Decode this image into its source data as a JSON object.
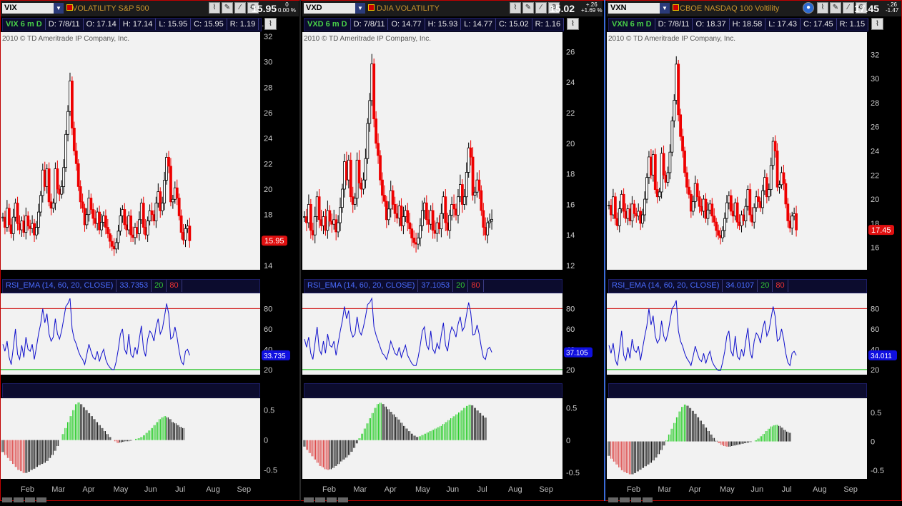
{
  "copyright": "2010 © TD Ameritrade IP Company, Inc.",
  "colors": {
    "up": "#000000",
    "down": "#ee0000",
    "rsi_line": "#1010cc",
    "overbought": "#cc0000",
    "oversold": "#00bb00",
    "macd_up": "#22cc22",
    "macd_down": "#dd4444",
    "bg": "#f2f2f2"
  },
  "icons": [
    "chart-style-icon",
    "drawing-icon",
    "studies-icon",
    "settings-icon"
  ],
  "panels": [
    {
      "symbol": "VIX",
      "description": "VOLATILITY S&P 500",
      "price": "15.95",
      "change": "0",
      "change_pct": "0.00 %",
      "info": {
        "name": "VIX 6 m D",
        "date": "D: 7/8/11",
        "open": "O: 17.14",
        "high": "H: 17.14",
        "low": "L: 15.95",
        "close": "C: 15.95",
        "range": "R: 1.19",
        "more": "..."
      },
      "price_tag": "15.95",
      "rsi": {
        "label": "RSI_EMA (14, 60, 20, CLOSE)",
        "value": "33.7353",
        "ob": "20",
        "os": "80",
        "tag": "33.735"
      }
    },
    {
      "symbol": "VXD",
      "description": "DJIA VOLATILITY",
      "price": "15.02",
      "change": "+.26",
      "change_pct": "+1.69 %",
      "info": {
        "name": "VXD 6 m D",
        "date": "D: 7/8/11",
        "open": "O: 14.77",
        "high": "H: 15.93",
        "low": "L: 14.77",
        "close": "C: 15.02",
        "range": "R: 1.16",
        "more": "..."
      },
      "price_tag": "",
      "rsi": {
        "label": "RSI_EMA (14, 60, 20, CLOSE)",
        "value": "37.1053",
        "ob": "20",
        "os": "80",
        "tag": "37.105"
      }
    },
    {
      "symbol": "VXN",
      "description": "CBOE NASDAQ 100 Voltility",
      "price": "17.45",
      "change": "-.26",
      "change_pct": "-1.47",
      "info": {
        "name": "VXN 6 m D",
        "date": "D: 7/8/11",
        "open": "O: 18.37",
        "high": "H: 18.58",
        "low": "L: 17.43",
        "close": "C: 17.45",
        "range": "R: 1.15",
        "more": "..."
      },
      "price_tag": "17.45",
      "rsi": {
        "label": "RSI_EMA (14, 60, 20, CLOSE)",
        "value": "34.0107",
        "ob": "20",
        "os": "80",
        "tag": "34.011"
      }
    }
  ],
  "chart_data": [
    {
      "type": "line",
      "title": "VIX 6 m D",
      "x_ticks": [
        "Feb",
        "Mar",
        "Apr",
        "May",
        "Jun",
        "Jul",
        "Aug",
        "Sep"
      ],
      "price_axis": {
        "ticks": [
          14,
          16,
          18,
          20,
          22,
          24,
          26,
          28,
          30,
          32
        ],
        "ylim": [
          14,
          32
        ]
      },
      "close": [
        17.8,
        17.0,
        18.5,
        17.2,
        16.5,
        17.8,
        18.9,
        17.3,
        16.8,
        17.5,
        16.6,
        17.9,
        17.1,
        16.9,
        17.3,
        16.4,
        17.0,
        18.2,
        19.5,
        21.5,
        20.2,
        21.6,
        19.0,
        18.5,
        18.9,
        21.6,
        20.0,
        19.6,
        20.2,
        21.7,
        24.3,
        26.1,
        28.5,
        24.8,
        23.0,
        22.0,
        20.2,
        19.0,
        18.5,
        17.2,
        18.0,
        19.3,
        18.4,
        17.7,
        17.3,
        18.2,
        16.8,
        17.4,
        17.9,
        17.0,
        16.5,
        15.9,
        15.5,
        15.3,
        15.8,
        16.7,
        17.9,
        18.4,
        17.2,
        16.8,
        17.9,
        16.4,
        16.2,
        17.0,
        16.5,
        17.6,
        18.9,
        17.0,
        16.4,
        17.5,
        18.3,
        18.0,
        17.5,
        18.9,
        19.8,
        18.3,
        18.9,
        20.7,
        22.5,
        21.8,
        19.0,
        19.2,
        20.1,
        19.3,
        17.9,
        16.6,
        16.0,
        16.9,
        17.1,
        15.95
      ],
      "rsi_axis": {
        "ticks": [
          20,
          40,
          60,
          80
        ],
        "ylim": [
          15,
          95
        ]
      },
      "rsi": [
        45,
        38,
        48,
        32,
        25,
        42,
        60,
        35,
        30,
        44,
        32,
        52,
        40,
        38,
        45,
        30,
        42,
        55,
        65,
        80,
        66,
        75,
        55,
        48,
        52,
        70,
        55,
        50,
        58,
        70,
        82,
        85,
        90,
        60,
        50,
        45,
        38,
        33,
        30,
        25,
        35,
        45,
        38,
        32,
        30,
        38,
        28,
        35,
        40,
        30,
        25,
        22,
        20,
        20,
        28,
        40,
        55,
        60,
        40,
        35,
        55,
        35,
        32,
        42,
        35,
        50,
        63,
        40,
        33,
        50,
        58,
        55,
        48,
        62,
        70,
        55,
        60,
        72,
        85,
        75,
        50,
        52,
        62,
        52,
        38,
        28,
        25,
        38,
        40,
        34
      ],
      "macd_axis": {
        "ticks": [
          -0.5,
          0,
          0.5
        ],
        "ylim": [
          -0.65,
          0.7
        ]
      },
      "macd": [
        -0.2,
        -0.25,
        -0.3,
        -0.35,
        -0.4,
        -0.45,
        -0.5,
        -0.52,
        -0.55,
        -0.55,
        -0.53,
        -0.5,
        -0.48,
        -0.45,
        -0.42,
        -0.4,
        -0.38,
        -0.35,
        -0.3,
        -0.25,
        -0.18,
        -0.1,
        0.0,
        0.1,
        0.2,
        0.3,
        0.4,
        0.5,
        0.6,
        0.63,
        0.6,
        0.55,
        0.5,
        0.45,
        0.4,
        0.35,
        0.3,
        0.25,
        0.2,
        0.15,
        0.1,
        0.05,
        0.0,
        -0.02,
        -0.05,
        -0.04,
        -0.03,
        -0.02,
        -0.02,
        -0.01,
        0.0,
        0.02,
        0.03,
        0.05,
        0.08,
        0.12,
        0.16,
        0.2,
        0.25,
        0.3,
        0.35,
        0.38,
        0.4,
        0.38,
        0.35,
        0.3,
        0.28,
        0.25,
        0.22,
        0.2
      ]
    },
    {
      "type": "line",
      "title": "VXD 6 m D",
      "x_ticks": [
        "Feb",
        "Mar",
        "Apr",
        "May",
        "Jun",
        "Jul",
        "Aug",
        "Sep"
      ],
      "price_axis": {
        "ticks": [
          12,
          14,
          16,
          18,
          20,
          22,
          24,
          26
        ],
        "ylim": [
          12,
          27
        ]
      },
      "close": [
        15.2,
        14.8,
        16.0,
        14.3,
        14.0,
        15.2,
        16.5,
        15.0,
        14.6,
        15.2,
        14.3,
        15.6,
        14.9,
        14.7,
        15.0,
        14.2,
        14.8,
        15.8,
        17.0,
        18.8,
        17.6,
        18.9,
        16.5,
        16.0,
        16.4,
        18.9,
        17.4,
        17.0,
        17.6,
        19.0,
        21.3,
        22.8,
        25.2,
        21.6,
        20.0,
        19.2,
        17.6,
        16.6,
        16.2,
        15.0,
        15.7,
        16.9,
        16.0,
        15.4,
        15.1,
        15.9,
        14.6,
        15.2,
        15.6,
        14.8,
        14.4,
        13.8,
        13.5,
        13.4,
        13.8,
        14.6,
        15.6,
        16.1,
        15.0,
        14.7,
        15.6,
        14.3,
        14.1,
        14.8,
        14.4,
        15.4,
        16.5,
        14.8,
        14.3,
        15.3,
        16.0,
        15.7,
        15.3,
        16.5,
        17.3,
        16.0,
        16.5,
        18.1,
        19.7,
        19.1,
        16.6,
        16.8,
        17.6,
        16.9,
        15.6,
        14.5,
        14.0,
        14.8,
        14.9,
        15.02
      ],
      "rsi_axis": {
        "ticks": [
          20,
          40,
          60,
          80
        ],
        "ylim": [
          15,
          95
        ]
      },
      "rsi": [
        50,
        42,
        52,
        36,
        30,
        46,
        62,
        40,
        35,
        48,
        36,
        55,
        44,
        42,
        48,
        34,
        46,
        58,
        68,
        82,
        70,
        78,
        58,
        52,
        55,
        72,
        58,
        54,
        62,
        72,
        84,
        86,
        90,
        62,
        54,
        48,
        42,
        36,
        34,
        30,
        38,
        48,
        42,
        36,
        34,
        42,
        32,
        38,
        44,
        34,
        30,
        26,
        24,
        24,
        32,
        44,
        58,
        62,
        44,
        40,
        58,
        40,
        36,
        46,
        40,
        54,
        66,
        44,
        38,
        54,
        62,
        58,
        52,
        65,
        72,
        58,
        62,
        74,
        86,
        76,
        54,
        55,
        64,
        55,
        42,
        32,
        30,
        40,
        42,
        37
      ],
      "macd_axis": {
        "ticks": [
          -0.5,
          0,
          0.5
        ],
        "ylim": [
          -0.6,
          0.65
        ]
      },
      "macd": [
        -0.1,
        -0.15,
        -0.2,
        -0.25,
        -0.3,
        -0.35,
        -0.4,
        -0.42,
        -0.45,
        -0.46,
        -0.45,
        -0.43,
        -0.4,
        -0.37,
        -0.33,
        -0.3,
        -0.27,
        -0.23,
        -0.18,
        -0.12,
        -0.05,
        0.03,
        0.1,
        0.18,
        0.26,
        0.34,
        0.42,
        0.5,
        0.56,
        0.58,
        0.56,
        0.52,
        0.48,
        0.44,
        0.4,
        0.36,
        0.32,
        0.27,
        0.22,
        0.18,
        0.14,
        0.1,
        0.07,
        0.05,
        0.06,
        0.08,
        0.1,
        0.12,
        0.14,
        0.16,
        0.18,
        0.2,
        0.22,
        0.25,
        0.28,
        0.31,
        0.34,
        0.37,
        0.4,
        0.43,
        0.46,
        0.5,
        0.53,
        0.55,
        0.54,
        0.5,
        0.46,
        0.42,
        0.38,
        0.35
      ]
    },
    {
      "type": "line",
      "title": "VXN 6 m D",
      "x_ticks": [
        "Feb",
        "Mar",
        "Apr",
        "May",
        "Jun",
        "Jul",
        "Aug",
        "Sep"
      ],
      "price_axis": {
        "ticks": [
          16,
          18,
          20,
          22,
          24,
          26,
          28,
          30,
          32
        ],
        "ylim": [
          14.5,
          33.5
        ]
      },
      "close": [
        19.5,
        18.7,
        20.2,
        18.4,
        17.8,
        19.2,
        20.4,
        19.0,
        18.4,
        19.2,
        18.2,
        19.6,
        18.8,
        18.6,
        19.0,
        18.0,
        18.7,
        20.0,
        21.8,
        23.5,
        22.0,
        23.7,
        20.8,
        20.2,
        20.6,
        23.8,
        22.0,
        21.4,
        22.2,
        23.9,
        26.5,
        28.2,
        31.2,
        27.0,
        25.2,
        24.0,
        22.2,
        21.0,
        20.4,
        19.0,
        19.8,
        21.3,
        20.2,
        19.4,
        19.0,
        20.0,
        18.4,
        19.1,
        19.6,
        18.6,
        18.1,
        17.4,
        17.0,
        16.8,
        17.4,
        18.4,
        19.7,
        20.3,
        19.0,
        18.6,
        19.7,
        18.1,
        17.8,
        18.7,
        18.2,
        19.4,
        20.8,
        18.7,
        18.1,
        19.3,
        20.2,
        19.8,
        19.3,
        20.7,
        21.8,
        20.2,
        20.8,
        22.8,
        24.8,
        24.0,
        21.0,
        21.2,
        22.2,
        21.3,
        19.6,
        18.2,
        17.6,
        18.6,
        18.8,
        17.45
      ],
      "rsi_axis": {
        "ticks": [
          20,
          40,
          60,
          80
        ],
        "ylim": [
          15,
          95
        ]
      },
      "rsi": [
        44,
        36,
        46,
        30,
        24,
        40,
        58,
        34,
        29,
        42,
        31,
        50,
        39,
        37,
        43,
        29,
        41,
        53,
        63,
        80,
        64,
        73,
        53,
        46,
        50,
        68,
        53,
        48,
        56,
        68,
        80,
        83,
        88,
        58,
        48,
        43,
        36,
        31,
        28,
        24,
        33,
        43,
        36,
        30,
        28,
        36,
        26,
        33,
        38,
        28,
        24,
        21,
        19,
        19,
        27,
        38,
        53,
        58,
        38,
        33,
        53,
        33,
        30,
        40,
        33,
        48,
        61,
        38,
        31,
        48,
        56,
        53,
        46,
        60,
        68,
        53,
        58,
        70,
        82,
        72,
        48,
        50,
        60,
        50,
        36,
        27,
        24,
        36,
        38,
        34
      ],
      "macd_axis": {
        "ticks": [
          -0.5,
          0,
          0.5
        ],
        "ylim": [
          -0.65,
          0.75
        ]
      },
      "macd": [
        -0.25,
        -0.3,
        -0.35,
        -0.4,
        -0.45,
        -0.5,
        -0.53,
        -0.55,
        -0.57,
        -0.57,
        -0.55,
        -0.52,
        -0.49,
        -0.46,
        -0.43,
        -0.4,
        -0.37,
        -0.33,
        -0.28,
        -0.22,
        -0.15,
        -0.07,
        0.02,
        0.12,
        0.22,
        0.32,
        0.42,
        0.52,
        0.6,
        0.64,
        0.62,
        0.58,
        0.53,
        0.48,
        0.42,
        0.36,
        0.3,
        0.24,
        0.18,
        0.12,
        0.06,
        0.01,
        -0.03,
        -0.06,
        -0.08,
        -0.09,
        -0.09,
        -0.08,
        -0.07,
        -0.06,
        -0.05,
        -0.04,
        -0.03,
        -0.02,
        -0.01,
        0.0,
        0.02,
        0.05,
        0.09,
        0.13,
        0.18,
        0.22,
        0.26,
        0.28,
        0.29,
        0.27,
        0.24,
        0.2,
        0.17,
        0.15
      ]
    }
  ]
}
